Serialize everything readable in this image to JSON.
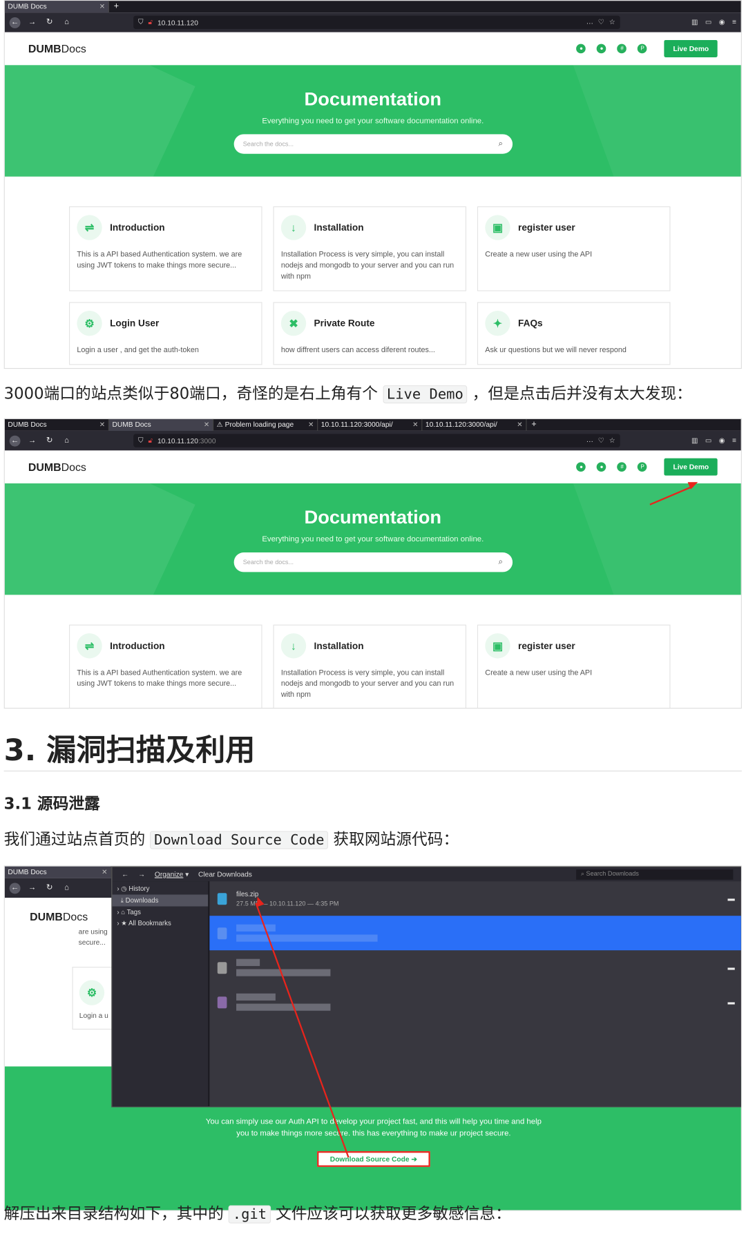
{
  "browser1": {
    "tabs": [
      {
        "label": "DUMB Docs"
      }
    ],
    "url": "10.10.11.120"
  },
  "browser2": {
    "tabs": [
      {
        "label": "DUMB Docs"
      },
      {
        "label": "DUMB Docs"
      },
      {
        "label": "Problem loading page"
      },
      {
        "label": "10.10.11.120:3000/api/"
      },
      {
        "label": "10.10.11.120:3000/api/"
      }
    ],
    "url": "10.10.11.120",
    "url_port": ":3000"
  },
  "site": {
    "logo_bold": "DUMB",
    "logo_rest": "Docs",
    "live_demo": "Live Demo",
    "hero_title": "Documentation",
    "hero_sub": "Everything you need to get your software documentation online.",
    "search_placeholder": "Search the docs...",
    "cards": [
      {
        "title": "Introduction",
        "desc": "This is a API based Authentication system. we are using JWT tokens to make things more secure...",
        "icon": "signpost-icon"
      },
      {
        "title": "Installation",
        "desc": "Installation Process is very simple, you can install nodejs and mongodb to your server and you can run with npm",
        "icon": "download-arrow-icon"
      },
      {
        "title": "register user",
        "desc": "Create a new user using the API",
        "icon": "box-icon"
      },
      {
        "title": "Login User",
        "desc": "Login a user , and get the auth-token",
        "icon": "gears-icon"
      },
      {
        "title": "Private Route",
        "desc": "how diffrent users can access diferent routes...",
        "icon": "tools-icon"
      },
      {
        "title": "FAQs",
        "desc": "Ask ur questions but we will never respond",
        "icon": "lightbulb-icon"
      }
    ]
  },
  "article": {
    "p1_a": "3000端口的站点类似于80端口，奇怪的是右上角有个",
    "p1_code": "Live Demo",
    "p1_b": "，但是点击后并没有太大发现：",
    "h1": "3. 漏洞扫描及利用",
    "h3": "3.1 源码泄露",
    "p2_a": "我们通过站点首页的",
    "p2_code": "Download Source Code",
    "p2_b": "获取网站源代码：",
    "p3_a": "解压出来目录结构如下，其中的",
    "p3_code": ".git",
    "p3_b": "文件应该可以获取更多敏感信息："
  },
  "downloads": {
    "tab": "DUMB Docs",
    "organize": "Organize",
    "clear": "Clear Downloads",
    "search_placeholder": "Search Downloads",
    "sidebar": [
      "History",
      "Downloads",
      "Tags",
      "All Bookmarks"
    ],
    "file_name": "files.zip",
    "file_meta": "27.5 MB — 10.10.11.120 — 4:35 PM",
    "bg_text1": "are using",
    "bg_text2": "secure...",
    "bg_text3": "Login a u",
    "bottom_line1": "You can simply use our Auth API to develop your project fast, and this will help you time and help",
    "bottom_line2": "you to make things more secure. this has everything to make ur project secure.",
    "download_button": "Download Source Code"
  },
  "colors": {
    "accent": "#2dbe66",
    "arrow": "#e8241c"
  }
}
